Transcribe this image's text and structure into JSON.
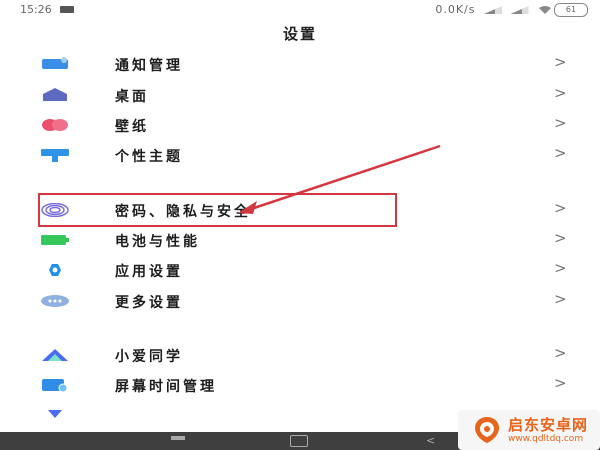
{
  "status_bar": {
    "time": "15:26",
    "net_speed": "0.0K/s",
    "battery": "61"
  },
  "page": {
    "title": "设置"
  },
  "groups": [
    {
      "items": [
        {
          "label": "通知管理",
          "icon": "notification-icon",
          "color": "#3a8ee6"
        },
        {
          "label": "桌面",
          "icon": "home-icon",
          "color": "#5c6bc0"
        },
        {
          "label": "壁纸",
          "icon": "flower-icon",
          "color": "#e8506e"
        },
        {
          "label": "个性主题",
          "icon": "brush-icon",
          "color": "#2f94e8"
        }
      ]
    },
    {
      "items": [
        {
          "label": "密码、隐私与安全",
          "icon": "fingerprint-icon",
          "color": "#7a6fe0"
        },
        {
          "label": "电池与性能",
          "icon": "battery-icon",
          "color": "#34c759"
        },
        {
          "label": "应用设置",
          "icon": "gear-icon",
          "color": "#1e90e8"
        },
        {
          "label": "更多设置",
          "icon": "more-icon",
          "color": "#8fb0e0"
        }
      ]
    },
    {
      "items": [
        {
          "label": "小爱同学",
          "icon": "xiaoai-icon",
          "color": "#4a6cf0"
        },
        {
          "label": "屏幕时间管理",
          "icon": "screen-time-icon",
          "color": "#2f8de6"
        }
      ]
    }
  ],
  "arrow_glyph": ">",
  "annotation": {
    "color": "#d3373f"
  },
  "watermark": {
    "title": "启东安卓网",
    "url": "www.qdltdq.com",
    "color": "#e8631b"
  }
}
